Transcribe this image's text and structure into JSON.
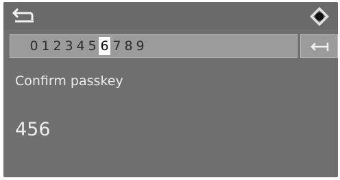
{
  "toolbar": {
    "back_icon": "back-arrow-icon",
    "nav_icon": "controller-icon"
  },
  "keypad": {
    "digits": [
      "0",
      "1",
      "2",
      "3",
      "4",
      "5",
      "6",
      "7",
      "8",
      "9"
    ],
    "selected_digit": "6",
    "enter_icon": "enter-arrow-icon"
  },
  "dialog": {
    "label": "Confirm passkey",
    "value": "456"
  },
  "colors": {
    "screen_bg": "#6f6f6f",
    "bar_bg": "#9b9b9b",
    "selected_bg": "#ffffff",
    "text": "#ededed"
  }
}
